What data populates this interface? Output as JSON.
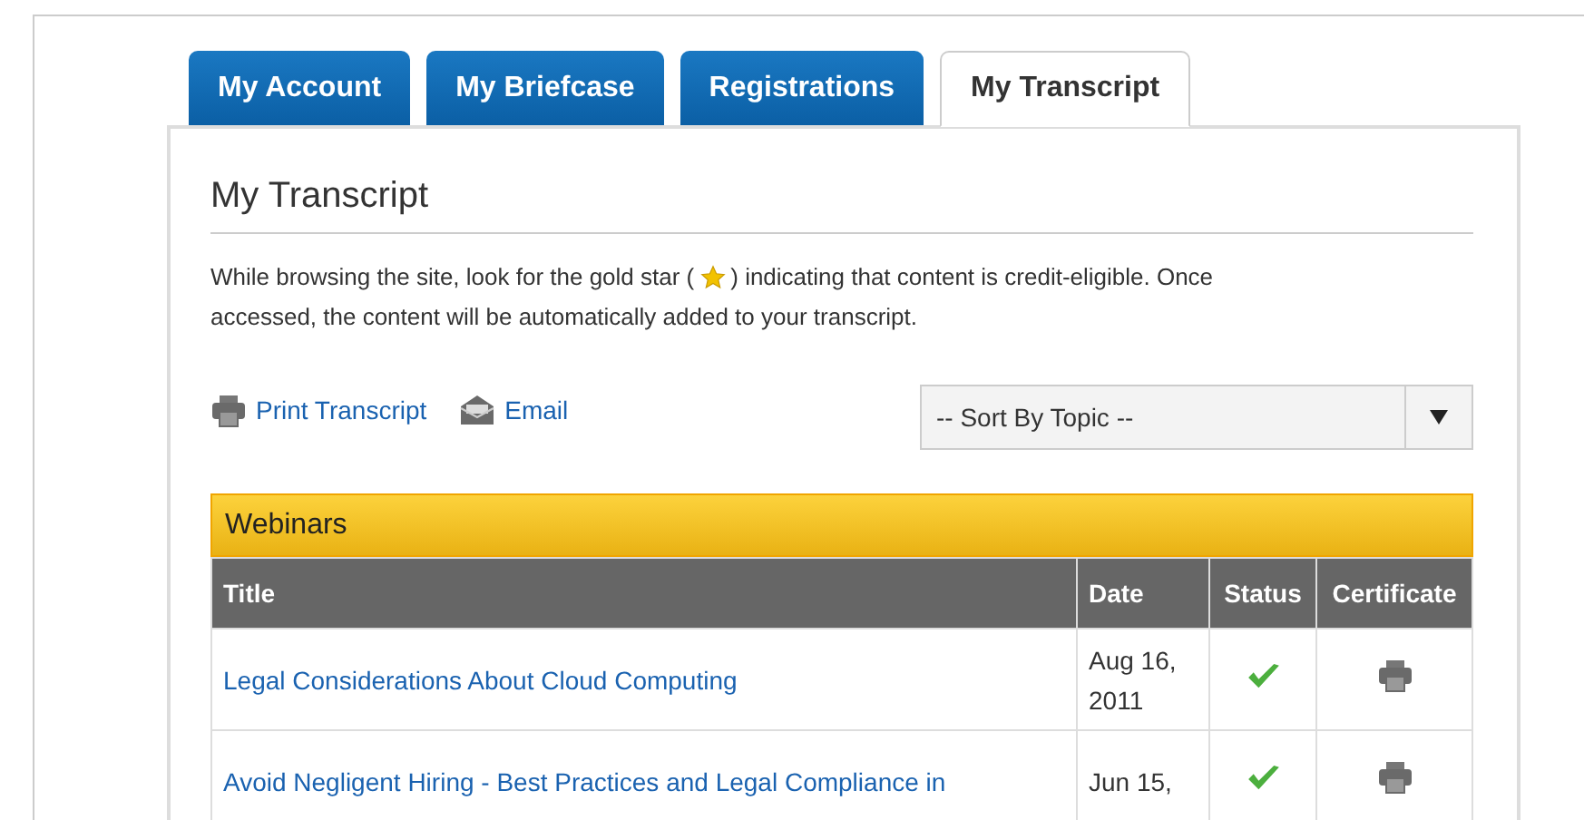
{
  "tabs": [
    {
      "label": "My Account",
      "selected": false
    },
    {
      "label": "My Briefcase",
      "selected": false
    },
    {
      "label": "Registrations",
      "selected": false
    },
    {
      "label": "My Transcript",
      "selected": true
    }
  ],
  "heading": "My Transcript",
  "description": {
    "before": "While browsing the site, look for the gold star (",
    "after": ") indicating that content is credit-eligible. Once",
    "continued": "accessed, the content will be automatically added to your transcript."
  },
  "actions": [
    {
      "kind": "print",
      "label": "Print Transcript"
    },
    {
      "kind": "email",
      "label": "Email"
    }
  ],
  "sort_select": {
    "value": "-- Sort By Topic --"
  },
  "section": {
    "title": "Webinars",
    "columns": [
      "Title",
      "Date",
      "Status",
      "Certificate"
    ],
    "rows": [
      {
        "title": "Legal Considerations About Cloud Computing",
        "date": "Aug 16, 2011",
        "completed": true
      },
      {
        "title": "Avoid Negligent Hiring - Best Practices and Legal Compliance in",
        "date": "Jun 15,",
        "completed": true
      }
    ]
  }
}
